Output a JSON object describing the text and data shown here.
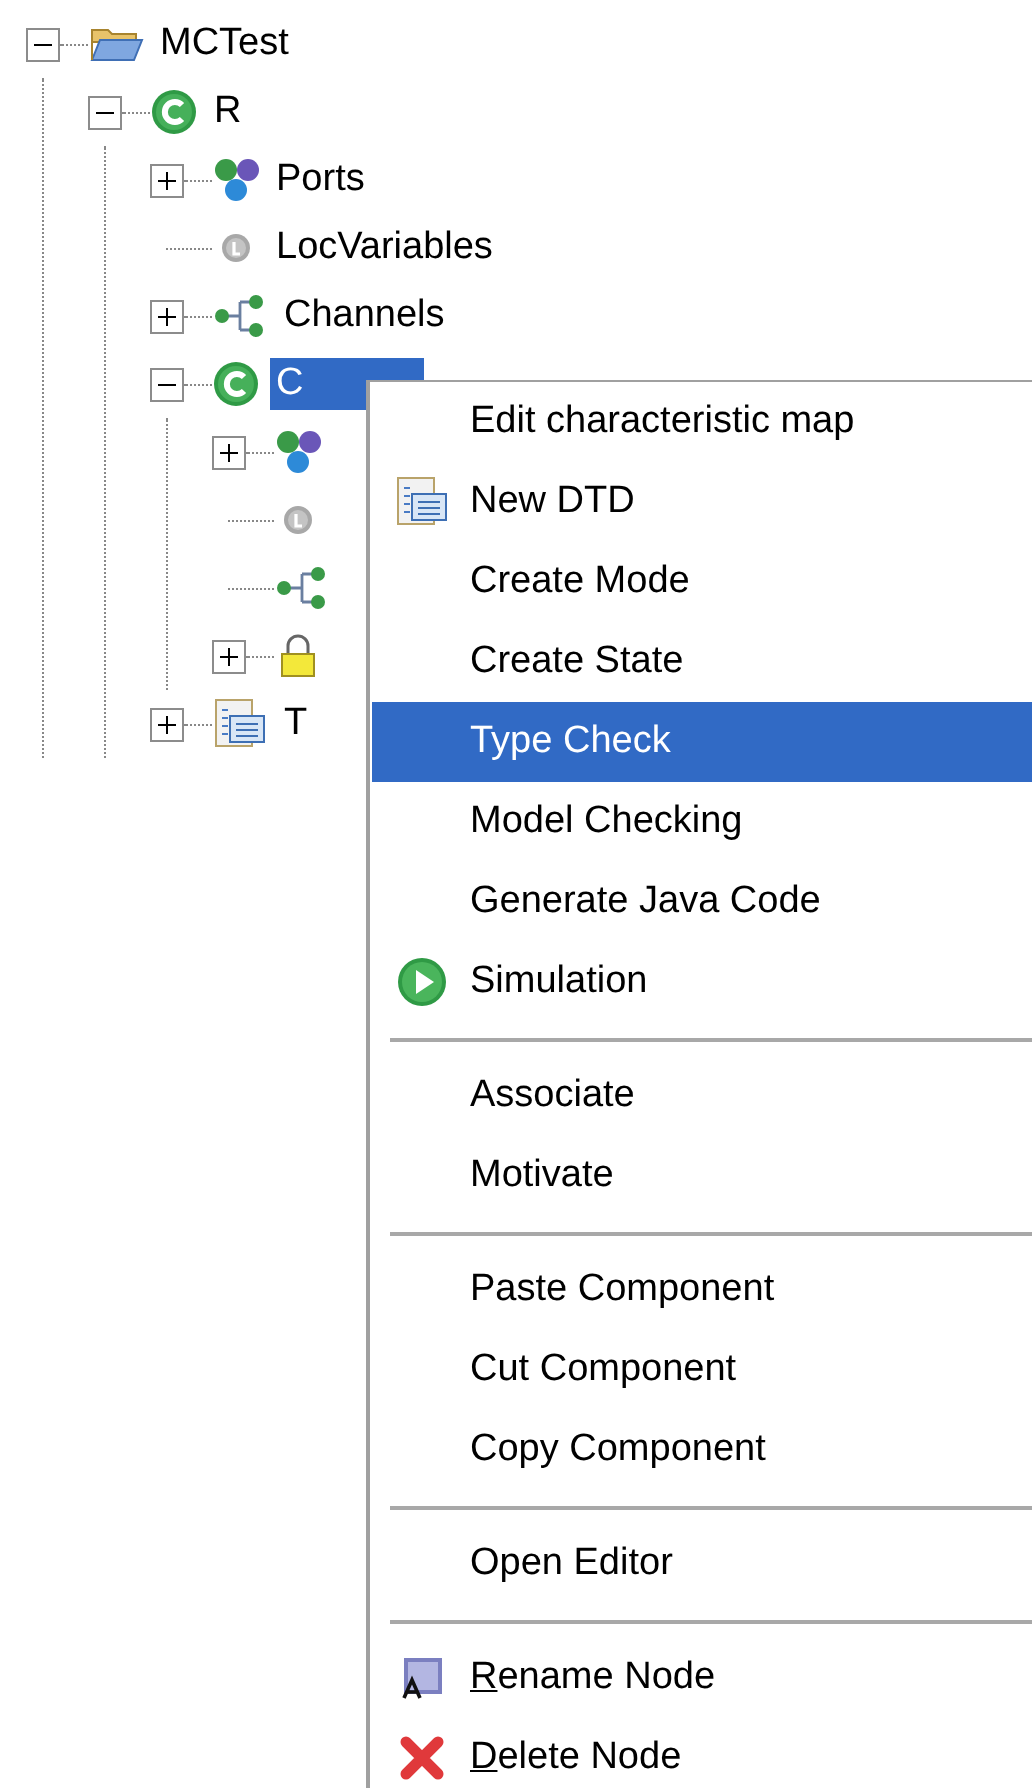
{
  "tree": [
    {
      "label": "MCTest",
      "kind": "folder",
      "expanded": true,
      "selected": false,
      "children": [
        {
          "label": "R",
          "kind": "component",
          "expanded": true,
          "selected": false,
          "children": [
            {
              "label": "Ports",
              "kind": "ports",
              "expanded": false,
              "selected": false
            },
            {
              "label": "LocVariables",
              "kind": "variable",
              "selected": false
            },
            {
              "label": "Channels",
              "kind": "channel",
              "expanded": false,
              "selected": false
            },
            {
              "label": "C",
              "kind": "component",
              "expanded": true,
              "selected": true,
              "children": [
                {
                  "kind": "ports",
                  "expanded": false
                },
                {
                  "kind": "variable"
                },
                {
                  "kind": "channel"
                },
                {
                  "kind": "lock",
                  "expanded": false
                }
              ]
            },
            {
              "label": "T",
              "kind": "document",
              "expanded": false,
              "selected": false
            }
          ]
        }
      ]
    }
  ],
  "context_menu": [
    {
      "kind": "plain",
      "label": "Edit characteristic map",
      "selected": false
    },
    {
      "kind": "document",
      "label": "New DTD",
      "selected": false
    },
    {
      "kind": "plain",
      "label": "Create Mode",
      "selected": false
    },
    {
      "kind": "plain",
      "label": "Create State",
      "selected": false
    },
    {
      "kind": "plain",
      "label": "Type Check",
      "selected": true
    },
    {
      "kind": "plain",
      "label": "Model Checking",
      "selected": false
    },
    {
      "kind": "plain",
      "label": "Generate Java Code",
      "selected": false
    },
    {
      "kind": "play",
      "label": "Simulation",
      "selected": false
    },
    {
      "kind": "separator"
    },
    {
      "kind": "plain",
      "label": "Associate",
      "selected": false
    },
    {
      "kind": "plain",
      "label": "Motivate",
      "selected": false
    },
    {
      "kind": "separator"
    },
    {
      "kind": "plain",
      "label": "Paste Component",
      "selected": false
    },
    {
      "kind": "plain",
      "label": "Cut Component",
      "selected": false
    },
    {
      "kind": "plain",
      "label": "Copy Component",
      "selected": false
    },
    {
      "kind": "separator"
    },
    {
      "kind": "plain",
      "label": "Open Editor",
      "selected": false
    },
    {
      "kind": "separator"
    },
    {
      "kind": "rename",
      "label": "Rename Node",
      "underline_first": true,
      "selected": false
    },
    {
      "kind": "delete",
      "label": "Delete Node",
      "underline_first": true,
      "selected": false
    }
  ]
}
